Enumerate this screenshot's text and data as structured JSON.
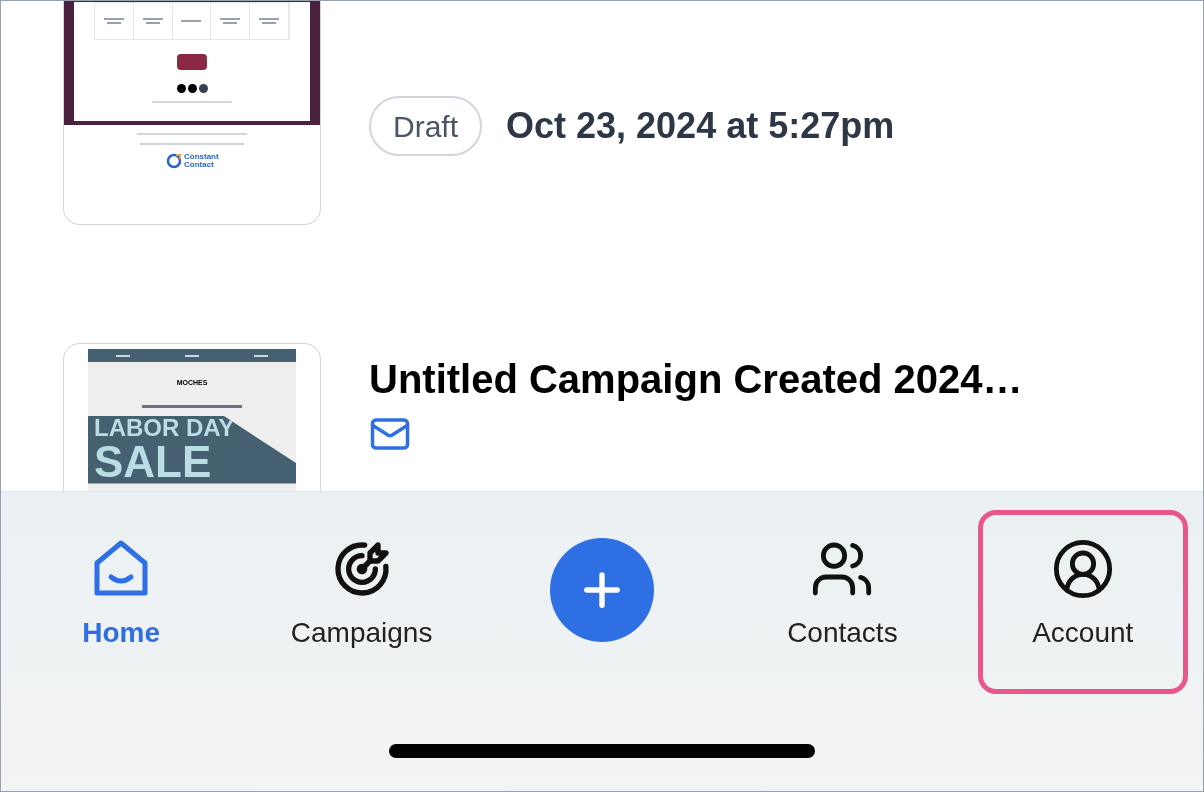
{
  "campaigns": [
    {
      "preview": {
        "kind": "schedule",
        "logo": "Constant Contact"
      },
      "status": "Draft",
      "date": "Oct 23, 2024 at 5:27pm"
    },
    {
      "preview": {
        "kind": "sale",
        "brand": "MOCHES",
        "headline": [
          "LABOR DAY",
          "SALE"
        ]
      },
      "title": "Untitled Campaign Created 2024…"
    }
  ],
  "tab_bar": [
    {
      "kind": "tab",
      "label": "Home",
      "selected": true,
      "highlighted": false
    },
    {
      "kind": "tab",
      "label": "Campaigns",
      "selected": false,
      "highlighted": false
    },
    {
      "kind": "add"
    },
    {
      "kind": "tab",
      "label": "Contacts",
      "selected": false,
      "highlighted": false
    },
    {
      "kind": "tab",
      "label": "Account",
      "selected": false,
      "highlighted": true
    }
  ]
}
